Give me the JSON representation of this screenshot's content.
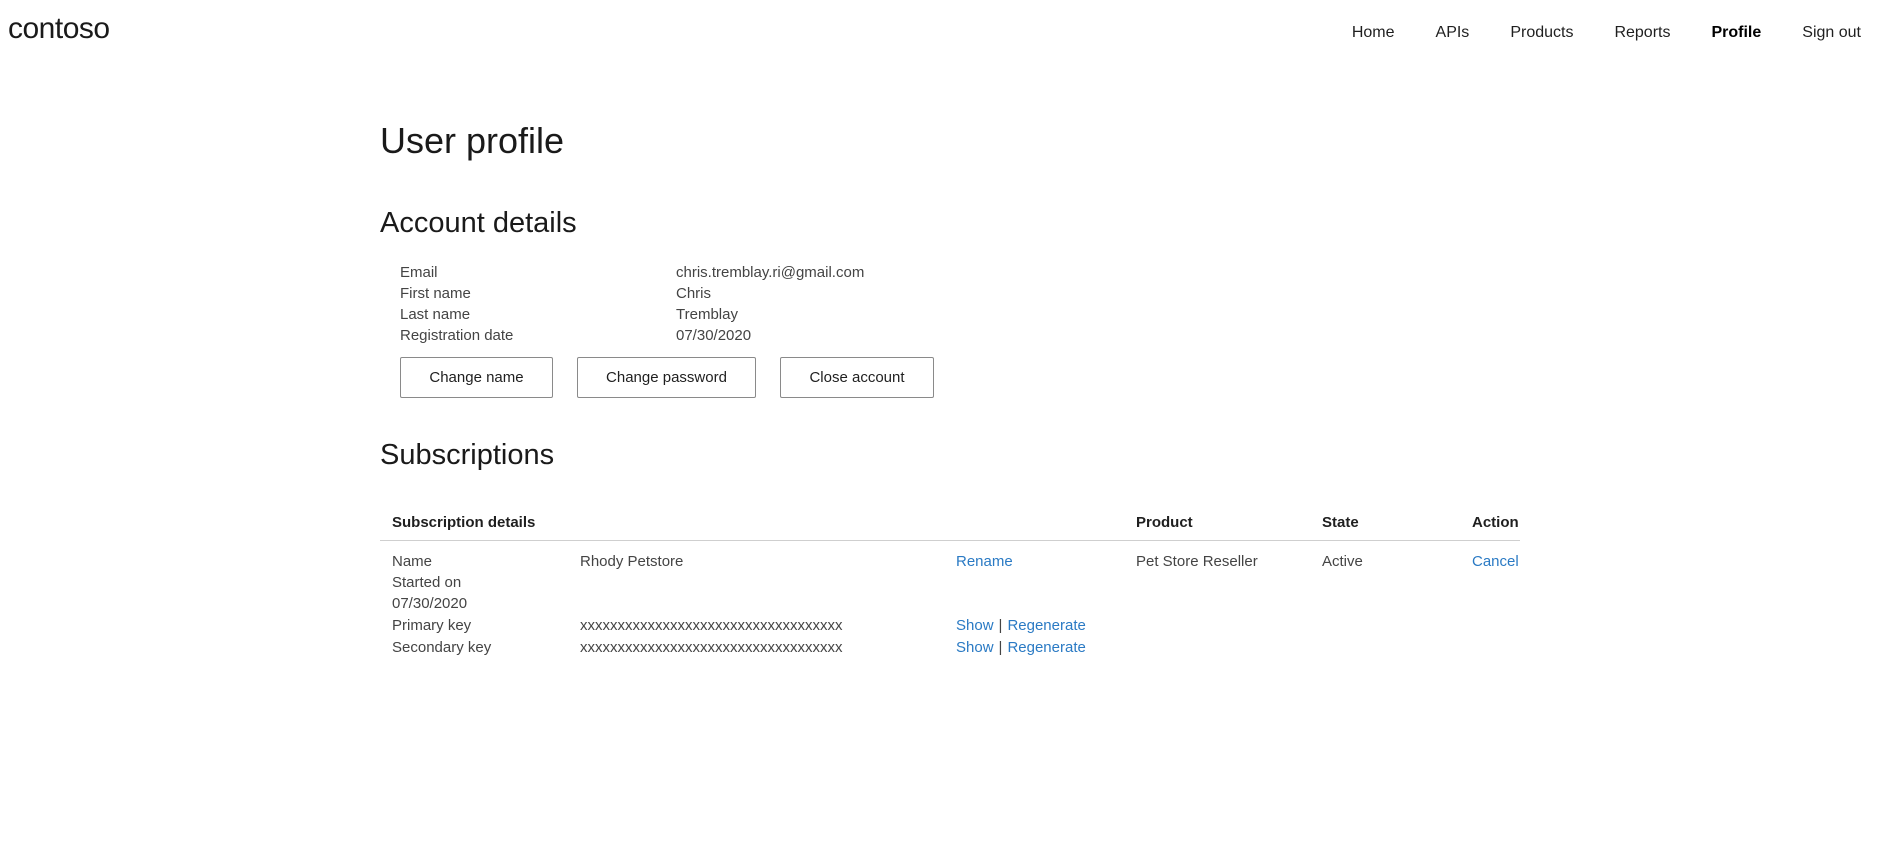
{
  "header": {
    "logo": "contoso",
    "nav": [
      {
        "label": "Home"
      },
      {
        "label": "APIs"
      },
      {
        "label": "Products"
      },
      {
        "label": "Reports"
      },
      {
        "label": "Profile",
        "active": true
      },
      {
        "label": "Sign out"
      }
    ]
  },
  "page": {
    "title": "User profile"
  },
  "account": {
    "heading": "Account details",
    "fields": [
      {
        "label": "Email",
        "value": "chris.tremblay.ri@gmail.com"
      },
      {
        "label": "First name",
        "value": "Chris"
      },
      {
        "label": "Last name",
        "value": "Tremblay"
      },
      {
        "label": "Registration date",
        "value": "07/30/2020"
      }
    ],
    "buttons": {
      "change_name": "Change name",
      "change_password": "Change password",
      "close_account": "Close account"
    }
  },
  "subscriptions": {
    "heading": "Subscriptions",
    "columns": {
      "details": "Subscription details",
      "product": "Product",
      "state": "State",
      "action": "Action"
    },
    "row": {
      "name_label": "Name",
      "name_value": "Rhody Petstore",
      "rename": "Rename",
      "started_label": "Started on",
      "started_value": "07/30/2020",
      "primary_label": "Primary key",
      "primary_value": "xxxxxxxxxxxxxxxxxxxxxxxxxxxxxxxxxxx",
      "secondary_label": "Secondary key",
      "secondary_value": "xxxxxxxxxxxxxxxxxxxxxxxxxxxxxxxxxxx",
      "show": "Show",
      "separator": "|",
      "regenerate": "Regenerate",
      "product": "Pet Store Reseller",
      "state": "Active",
      "action": "Cancel"
    }
  },
  "colors": {
    "link": "#2a7ac4",
    "text": "#444444",
    "heading": "#1a1a1a",
    "border": "#cfcfcf"
  }
}
